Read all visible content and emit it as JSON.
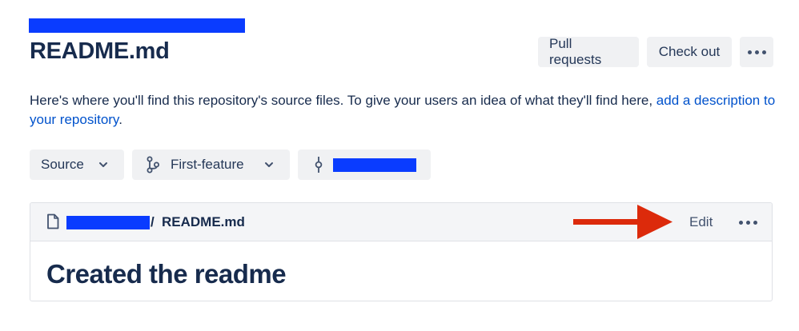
{
  "header": {
    "title": "README.md",
    "actions": {
      "pull_requests": "Pull requests",
      "check_out": "Check out",
      "more_icon": "more-horizontal-icon"
    }
  },
  "description": {
    "text": "Here's where you'll find this repository's source files. To give your users an idea of what they'll find here, ",
    "link": "add a description to your repository",
    "suffix": "."
  },
  "selectors": {
    "source": "Source",
    "branch": "First-feature",
    "branch_icon": "branch-icon",
    "commit_icon": "commit-icon"
  },
  "file": {
    "path_separator": "/",
    "name": "README.md",
    "edit": "Edit",
    "annotation_color": "#dc2a0b"
  },
  "readme": {
    "heading": "Created the readme"
  },
  "colors": {
    "redaction": "#0a3cff",
    "link": "#0052cc",
    "text": "#172b4d"
  }
}
